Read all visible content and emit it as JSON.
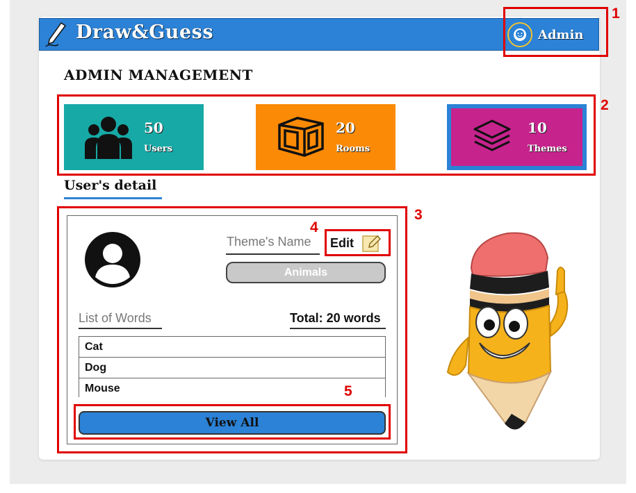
{
  "app": {
    "name": "Draw&Guess"
  },
  "header": {
    "user_label": "Admin"
  },
  "page_title": "ADMIN MANAGEMENT",
  "stats": [
    {
      "value": "50",
      "label": "Users",
      "icon": "users-icon",
      "color": "#17a9a6"
    },
    {
      "value": "20",
      "label": "Rooms",
      "icon": "room-cube-icon",
      "color": "#fb8a06"
    },
    {
      "value": "10",
      "label": "Themes",
      "icon": "layers-icon",
      "color": "#c6238d"
    }
  ],
  "tab": {
    "label": "User's detail"
  },
  "detail": {
    "theme_name_label": "Theme's Name",
    "edit_label": "Edit",
    "theme_value": "Animals",
    "list_label": "List of Words",
    "total_label": "Total: 20 words",
    "words": [
      "Cat",
      "Dog",
      "Mouse"
    ],
    "view_all_label": "View All"
  },
  "annotations": [
    "1",
    "2",
    "3",
    "4",
    "5"
  ],
  "colors": {
    "header": "#2b82d6",
    "annotation": "#e00000"
  }
}
